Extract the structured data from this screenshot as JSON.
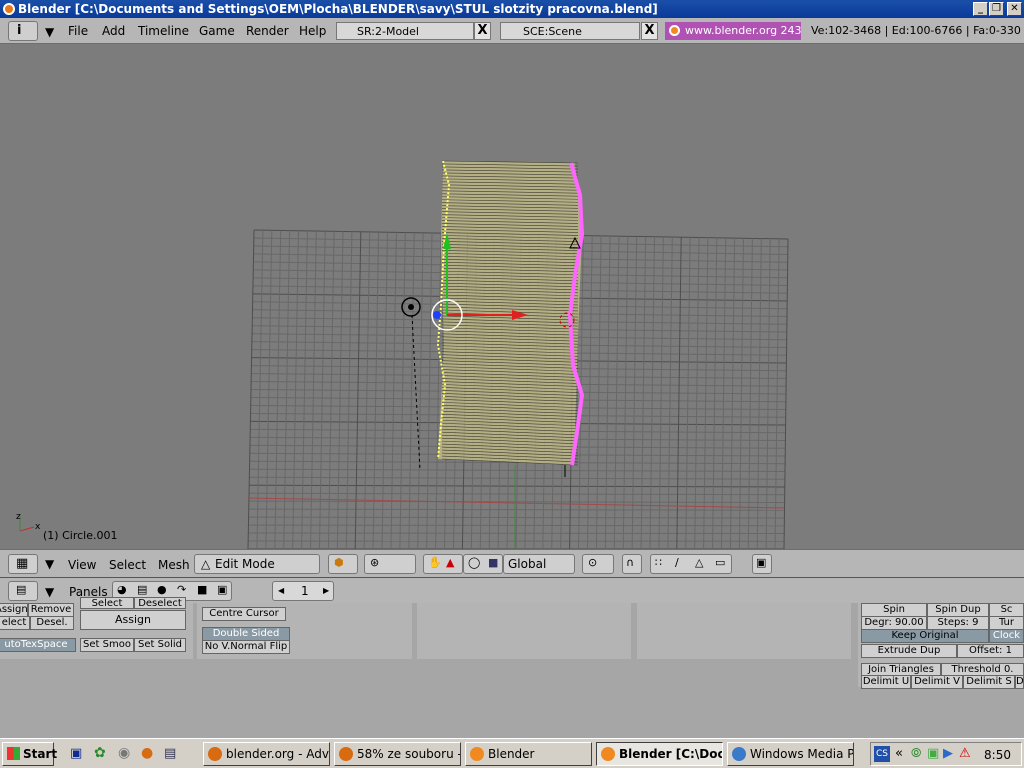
{
  "window": {
    "title": "Blender [C:\\Documents and Settings\\OEM\\Plocha\\BLENDER\\savy\\STUL slotzity pracovna.blend]",
    "min_label": "_",
    "max_label": "❐",
    "close_label": "✕"
  },
  "menu": {
    "items": [
      "File",
      "Add",
      "Timeline",
      "Game",
      "Render",
      "Help"
    ],
    "screen": "SR:2-Model",
    "scene": "SCE:Scene",
    "close_glyph": "X",
    "link": "www.blender.org 243",
    "stats": "Ve:102-3468 | Ed:100-6766 | Fa:0-330"
  },
  "viewport": {
    "object_label": "(1) Circle.001",
    "axis_x": "x",
    "axis_z": "z"
  },
  "view3d_header": {
    "view": "View",
    "select": "Select",
    "mesh": "Mesh",
    "mode": "Edit Mode",
    "orientation": "Global"
  },
  "buttons_header": {
    "panels": "Panels",
    "frame": "1",
    "arrow_left": "◀",
    "arrow_right": "▶"
  },
  "panels": {
    "link_materials": {
      "assign": "Assign",
      "remove": "Remove",
      "select": "elect",
      "deselect": "Desel.",
      "select2": "Select",
      "deselect2": "Deselect",
      "assign2": "Assign",
      "autotex": "utoTexSpace",
      "set_smooth": "Set Smoo",
      "set_solid": "Set Solid"
    },
    "mesh": {
      "centre_cursor": "Centre Cursor",
      "double_sided": "Double Sided",
      "no_vnormal_flip": "No V.Normal Flip"
    },
    "mesh_tools": {
      "spin": "Spin",
      "spin_dup": "Spin Dup",
      "sc": "Sc",
      "degr": "Degr: 90.00",
      "steps": "Steps: 9",
      "tur": "Tur",
      "keep_original": "Keep Original",
      "clock": "Clock",
      "extrude_dup": "Extrude Dup",
      "offset": "Offset: 1",
      "join_triangles": "Join Triangles",
      "threshold": "Threshold 0.",
      "delimit_u": "Delimit U",
      "delimit_v": "Delimit V",
      "delimit_s": "Delimit S",
      "d": "D"
    }
  },
  "taskbar": {
    "start": "Start",
    "tasks": [
      "blender.org - Adv...",
      "58% ze souboru -...",
      "Blender",
      "Blender [C:\\Doc...",
      "Windows Media Pl..."
    ],
    "clock": "8:50",
    "tray_label": "CS"
  },
  "colors": {
    "titlebar": "#0a3a9a",
    "link_bg": "#b052b4",
    "mesh_fill": "#c8c08a",
    "selected_edge": "#ff66ff",
    "grid": "#6a6a6a"
  }
}
